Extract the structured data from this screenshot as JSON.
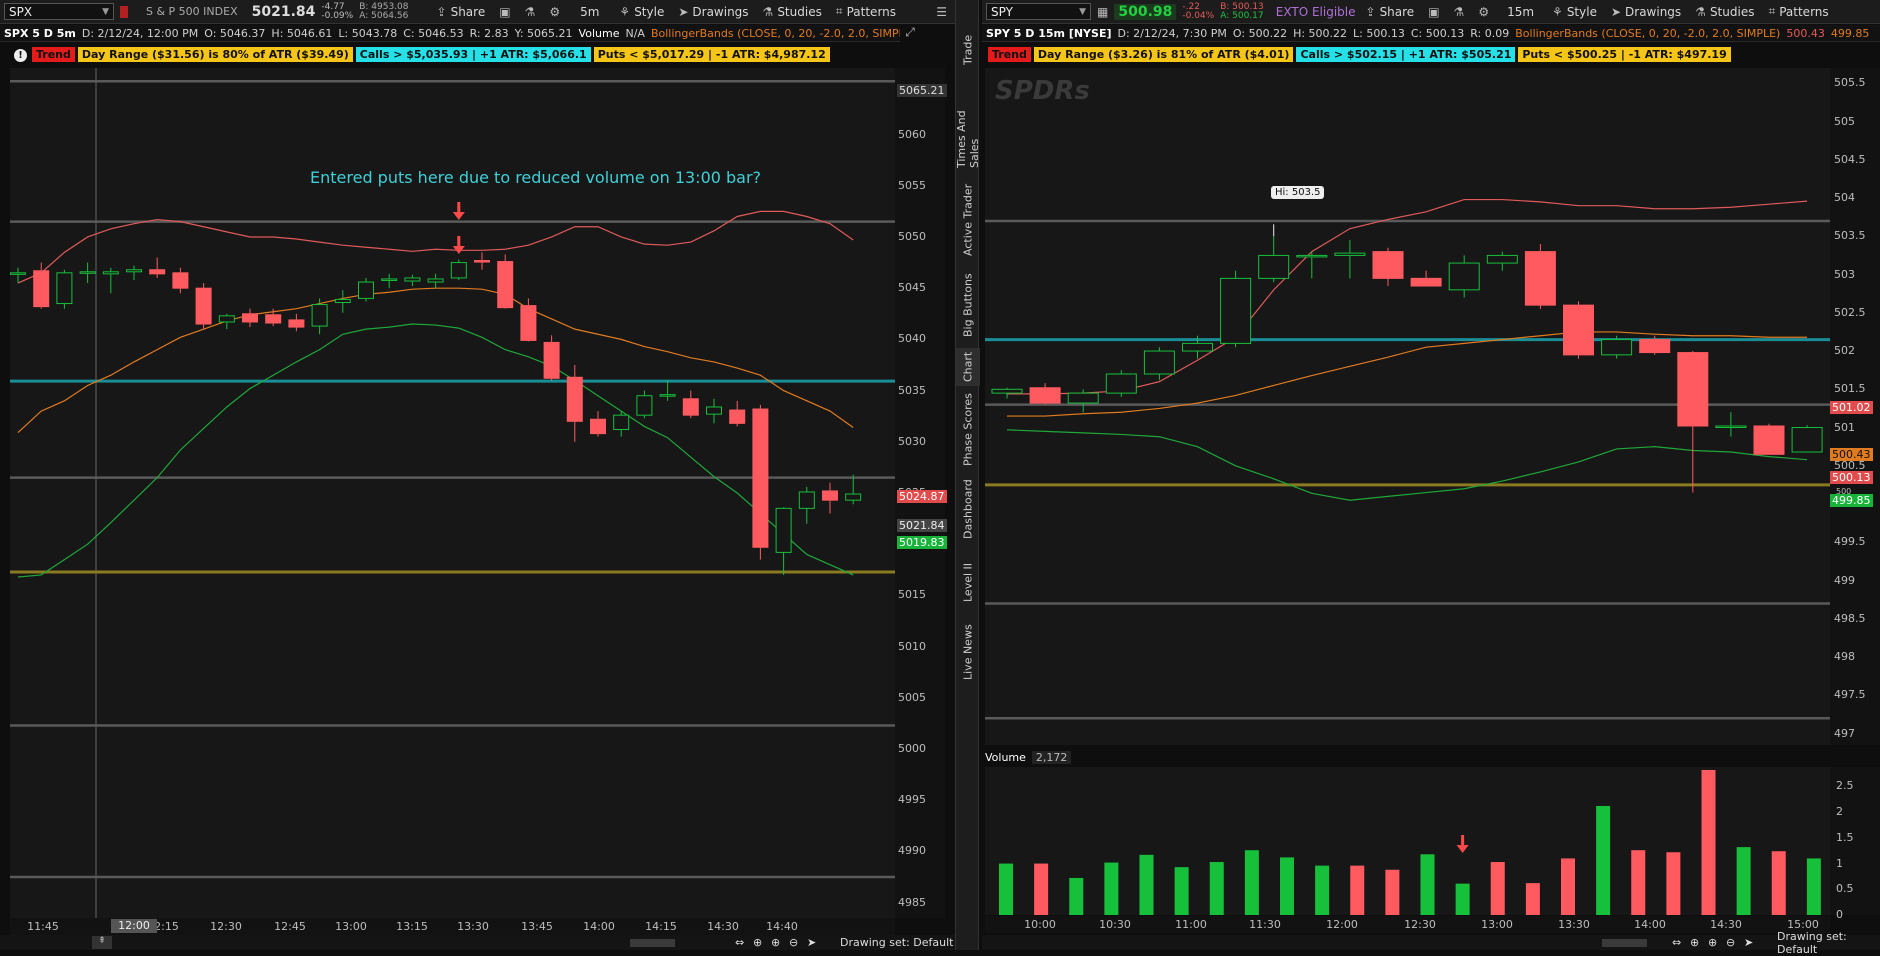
{
  "left": {
    "toolbar": {
      "symbol": "SPX",
      "name": "S & P 500 INDEX",
      "last": "5021.84",
      "change": "-4.77",
      "change_pct": "-0.09%",
      "bid": "B: 4953.08",
      "ask": "A: 5064.56",
      "share": "Share",
      "interval": "5m",
      "style": "Style",
      "drawings": "Drawings",
      "studies": "Studies",
      "patterns": "Patterns"
    },
    "info": {
      "title": "SPX 5 D 5m",
      "date": "D: 2/12/24, 12:00 PM",
      "open": "O: 5046.37",
      "high": "H: 5046.61",
      "low": "L: 5043.78",
      "close": "C: 5046.53",
      "range": "R: 2.83",
      "y": "Y: 5065.21",
      "volume_label": "Volume",
      "volume": "N/A",
      "study": "BollingerBands (CLOSE, 0, 20, -2.0, 2.0, SIMPLE)"
    },
    "tags": [
      "Trend",
      "Day Range ($31.56) is 80% of ATR ($39.49)",
      "Calls > $5,035.93 | +1 ATR: $5,066.1",
      "Puts < $5,017.29 | -1 ATR: $4,987.12"
    ],
    "annotation": "Entered puts here due to reduced volume on 13:00 bar?",
    "price_ticks": [
      "5060",
      "5055",
      "5050",
      "5045",
      "5040",
      "5035",
      "5030",
      "5025",
      "5020",
      "5015",
      "5010",
      "5005",
      "5000",
      "4995",
      "4990",
      "4985"
    ],
    "price_tags": {
      "top": "5065.21",
      "red": "5024.87",
      "gray": "5021.84",
      "green": "5019.83"
    },
    "x_ticks": [
      "11:45",
      "12:00",
      "12:15",
      "12:30",
      "12:45",
      "13:00",
      "13:15",
      "13:30",
      "13:45",
      "14:00",
      "14:15",
      "14:30",
      "14:40"
    ],
    "drawing_set": "Drawing set: Default"
  },
  "right": {
    "toolbar": {
      "symbol": "SPY",
      "last": "500.98",
      "change": "-.22",
      "change_pct": "-0.04%",
      "bid": "B: 500.13",
      "ask": "A: 500.17",
      "exto": "EXTO Eligible",
      "share": "Share",
      "interval": "15m",
      "style": "Style",
      "drawings": "Drawings",
      "studies": "Studies",
      "patterns": "Patterns"
    },
    "info": {
      "title": "SPY 5 D 15m [NYSE]",
      "date": "D: 2/12/24, 7:30 PM",
      "open": "O: 500.22",
      "high": "H: 500.22",
      "low": "L: 500.13",
      "close": "C: 500.13",
      "range": "R: 0.09",
      "study": "BollingerBands (CLOSE, 0, 20, -2.0, 2.0, SIMPLE)",
      "bb1": "500.43",
      "bb2": "499.85"
    },
    "tags": [
      "Trend",
      "Day Range ($3.26) is 81% of ATR ($4.01)",
      "Calls > $502.15 | +1 ATR: $505.21",
      "Puts < $500.25 | -1 ATR: $497.19"
    ],
    "watermark": "SPDRs",
    "hi_label": "Hi: 503.5",
    "price_ticks": [
      "505.5",
      "505",
      "504.5",
      "504",
      "503.5",
      "503",
      "502.5",
      "502",
      "501.5",
      "501",
      "500.5",
      "500",
      "499.5",
      "499",
      "498.5",
      "498",
      "497.5",
      "497"
    ],
    "price_tags": {
      "red1": "501.02",
      "orange": "500.43",
      "red2": "500.13",
      "green": "499.85",
      "tiny": "500"
    },
    "volume_label": "Volume",
    "volume_value": "2,172",
    "vol_ticks": [
      "2.5",
      "2",
      "1.5",
      "1",
      "0.5",
      "0"
    ],
    "x_ticks": [
      "10:00",
      "10:30",
      "11:00",
      "11:30",
      "12:00",
      "12:30",
      "13:00",
      "13:30",
      "14:00",
      "14:30",
      "15:00"
    ],
    "drawing_set": "Drawing set: Default"
  },
  "sidebar": [
    "Trade",
    "Times And Sales",
    "Active Trader",
    "Big Buttons",
    "Chart",
    "Phase Scores",
    "Dashboard",
    "Level II",
    "Live News"
  ],
  "colors": {
    "up": "#16c03b",
    "down": "#ff5a5f",
    "upper_band": "#e05a5a",
    "mid_band": "#e07b20",
    "lower_band": "#1fa83a",
    "cyan_line": "#1a8e96",
    "olive_line": "#8a7a20",
    "gray_line": "#666666",
    "annotation": "#3fd0d8"
  },
  "chart_data": [
    {
      "type": "candlestick",
      "title": "SPX 5 D 5m",
      "x": [
        "11:40",
        "11:45",
        "11:50",
        "11:55",
        "12:00",
        "12:05",
        "12:10",
        "12:15",
        "12:20",
        "12:25",
        "12:30",
        "12:35",
        "12:40",
        "12:45",
        "12:50",
        "12:55",
        "13:00",
        "13:05",
        "13:10",
        "13:15",
        "13:20",
        "13:25",
        "13:30",
        "13:35",
        "13:40",
        "13:45",
        "13:50",
        "13:55",
        "14:00",
        "14:05",
        "14:10",
        "14:15",
        "14:20",
        "14:25",
        "14:30",
        "14:35",
        "14:40"
      ],
      "ohlc": [
        [
          5046.5,
          5047,
          5045.5,
          5046.5
        ],
        [
          5046.7,
          5047.5,
          5043,
          5043.2
        ],
        [
          5043.5,
          5046.8,
          5043,
          5046.5
        ],
        [
          5046.5,
          5047.5,
          5045.5,
          5046.6
        ],
        [
          5046.4,
          5047,
          5044.5,
          5046.6
        ],
        [
          5046.6,
          5047.2,
          5045.8,
          5046.8
        ],
        [
          5046.8,
          5048,
          5046,
          5046.4
        ],
        [
          5046.5,
          5047,
          5044.5,
          5045
        ],
        [
          5045,
          5045.5,
          5041,
          5041.5
        ],
        [
          5041.7,
          5042.5,
          5041,
          5042.3
        ],
        [
          5042.5,
          5043,
          5041.2,
          5041.7
        ],
        [
          5042.4,
          5043,
          5041.3,
          5041.6
        ],
        [
          5041.9,
          5042.5,
          5040.8,
          5041.2
        ],
        [
          5041.3,
          5044,
          5040.5,
          5043.4
        ],
        [
          5043.6,
          5044.8,
          5042.6,
          5043.9
        ],
        [
          5044,
          5046,
          5043.7,
          5045.6
        ],
        [
          5045.8,
          5046.4,
          5045,
          5045.9
        ],
        [
          5045.7,
          5046.3,
          5045.2,
          5046
        ],
        [
          5045.6,
          5046.4,
          5045,
          5045.9
        ],
        [
          5046,
          5047.8,
          5045.8,
          5047.5
        ],
        [
          5047.7,
          5048.5,
          5046.8,
          5047.6
        ],
        [
          5047.6,
          5048.3,
          5043,
          5043.1
        ],
        [
          5043.3,
          5044,
          5039.8,
          5039.9
        ],
        [
          5039.7,
          5040.4,
          5036,
          5036.2
        ],
        [
          5036.3,
          5037.5,
          5030,
          5032
        ],
        [
          5032.2,
          5033,
          5030.5,
          5030.8
        ],
        [
          5031.2,
          5033,
          5030.5,
          5032.6
        ],
        [
          5032.6,
          5035,
          5032.3,
          5034.5
        ],
        [
          5034.5,
          5036,
          5034,
          5034.6
        ],
        [
          5034.2,
          5035,
          5032.3,
          5032.6
        ],
        [
          5032.7,
          5034.2,
          5031.8,
          5033.4
        ],
        [
          5033.1,
          5034,
          5031.5,
          5031.8
        ],
        [
          5033.2,
          5033.6,
          5018.5,
          5019.7
        ],
        [
          5019.2,
          5023.6,
          5017,
          5023.5
        ],
        [
          5023.5,
          5025.6,
          5022,
          5025.1
        ],
        [
          5025.2,
          5026,
          5023,
          5024.3
        ],
        [
          5024.3,
          5026.8,
          5023.9,
          5024.9
        ]
      ],
      "upper_band": [
        5045.5,
        5046.5,
        5048.5,
        5050,
        5050.8,
        5051.3,
        5051.7,
        5051.5,
        5051,
        5050.5,
        5050,
        5050,
        5049.8,
        5049.5,
        5049.2,
        5049,
        5048.8,
        5048.6,
        5048.8,
        5048.7,
        5048.7,
        5048.8,
        5049.2,
        5050,
        5051,
        5051,
        5050,
        5049.3,
        5049.2,
        5049.5,
        5050.6,
        5052,
        5052.5,
        5052.5,
        5052,
        5051.3,
        5049.7
      ],
      "middle_band": [
        5030.9,
        5033,
        5034,
        5035.5,
        5036.5,
        5037.8,
        5039,
        5040.2,
        5041,
        5041.8,
        5042.4,
        5042.7,
        5043,
        5043.5,
        5044,
        5044.4,
        5044.6,
        5044.9,
        5045,
        5045,
        5044.9,
        5044.4,
        5043,
        5042,
        5041,
        5040.5,
        5040,
        5039.3,
        5038.8,
        5038.2,
        5037.8,
        5037.2,
        5036.5,
        5035,
        5034,
        5033,
        5031.4
      ],
      "lower_band": [
        5016.8,
        5017,
        5018.5,
        5020,
        5022.1,
        5024.3,
        5026.5,
        5029.2,
        5031.3,
        5033.4,
        5035.2,
        5036.5,
        5037.8,
        5039,
        5040.5,
        5041,
        5041.2,
        5041.5,
        5041.4,
        5041.1,
        5040.2,
        5039,
        5038.3,
        5037.4,
        5036,
        5034.5,
        5033,
        5031.5,
        5030.4,
        5028.5,
        5026.6,
        5025,
        5023,
        5021,
        5019,
        5018,
        5017
      ],
      "hlines": {
        "gray": [
          5065.21,
          5051.5,
          5026.5,
          5002.3,
          4987.5
        ],
        "cyan": [
          5035.93
        ],
        "olive": [
          5017.29
        ]
      },
      "ylim": [
        4983.5,
        5066.5
      ],
      "annotations": [
        {
          "text": "Entered puts here due to reduced volume on 13:00 bar?",
          "x": "13:15"
        }
      ]
    },
    {
      "type": "candlestick",
      "title": "SPY 5 D 15m [NYSE]",
      "x": [
        "09:45",
        "10:00",
        "10:15",
        "10:30",
        "10:45",
        "11:00",
        "11:15",
        "11:30",
        "11:45",
        "12:00",
        "12:15",
        "12:30",
        "12:45",
        "13:00",
        "13:15",
        "13:30",
        "13:45",
        "14:00",
        "14:15",
        "14:30",
        "14:45",
        "15:00"
      ],
      "ohlc": [
        [
          501.45,
          501.52,
          501.38,
          501.5
        ],
        [
          501.52,
          501.58,
          501.3,
          501.32
        ],
        [
          501.32,
          501.5,
          501.2,
          501.45
        ],
        [
          501.45,
          501.75,
          501.4,
          501.7
        ],
        [
          501.7,
          502.05,
          501.62,
          502
        ],
        [
          502,
          502.2,
          501.9,
          502.1
        ],
        [
          502.1,
          503.05,
          502.05,
          502.95
        ],
        [
          502.95,
          503.5,
          502.9,
          503.25
        ],
        [
          503.25,
          503.3,
          502.95,
          503.25
        ],
        [
          503.25,
          503.45,
          502.95,
          503.28
        ],
        [
          503.3,
          503.35,
          502.85,
          502.95
        ],
        [
          502.95,
          503.05,
          502.85,
          502.85
        ],
        [
          502.8,
          503.25,
          502.7,
          503.15
        ],
        [
          503.15,
          503.3,
          503.05,
          503.25
        ],
        [
          503.3,
          503.4,
          502.55,
          502.6
        ],
        [
          502.6,
          502.65,
          501.9,
          501.95
        ],
        [
          501.95,
          502.2,
          501.9,
          502.15
        ],
        [
          502.15,
          502.2,
          501.95,
          501.98
        ],
        [
          501.98,
          502,
          500.15,
          501.02
        ],
        [
          501.02,
          501.2,
          500.88,
          501.02
        ],
        [
          501.02,
          501.05,
          500.65,
          500.65
        ],
        [
          500.68,
          501.03,
          500.68,
          501
        ]
      ],
      "upper_band": [
        501.44,
        501.44,
        501.45,
        501.48,
        501.6,
        501.88,
        502.18,
        502.8,
        503.3,
        503.6,
        503.72,
        503.82,
        503.98,
        503.98,
        503.95,
        503.9,
        503.9,
        503.86,
        503.86,
        503.88,
        503.92,
        503.96
      ],
      "middle_band": [
        501.15,
        501.15,
        501.18,
        501.2,
        501.25,
        501.32,
        501.42,
        501.55,
        501.68,
        501.8,
        501.92,
        502.05,
        502.1,
        502.15,
        502.2,
        502.25,
        502.25,
        502.22,
        502.2,
        502.2,
        502.18,
        502.18
      ],
      "lower_band": [
        500.97,
        500.95,
        500.93,
        500.91,
        500.88,
        500.75,
        500.5,
        500.33,
        500.14,
        500.05,
        500.1,
        500.15,
        500.2,
        500.3,
        500.42,
        500.55,
        500.72,
        500.75,
        500.7,
        500.68,
        500.62,
        500.58
      ],
      "hlines": {
        "gray": [
          503.7,
          501.3,
          498.7,
          497.2
        ],
        "cyan": [
          502.15
        ],
        "olive": [
          500.25
        ]
      },
      "ylim": [
        496.85,
        505.7
      ],
      "hi_label": "Hi: 503.5",
      "volume": {
        "ylim": [
          0,
          2.8
        ],
        "values": [
          1.0,
          1.0,
          0.72,
          1.02,
          1.17,
          0.93,
          1.03,
          1.26,
          1.12,
          0.96,
          0.96,
          0.88,
          1.18,
          0.61,
          1.03,
          0.62,
          1.1,
          2.12,
          1.26,
          1.22,
          2.82,
          1.32,
          1.24,
          1.1
        ],
        "colors": [
          "up",
          "down",
          "up",
          "up",
          "up",
          "up",
          "up",
          "up",
          "up",
          "up",
          "down",
          "down",
          "up",
          "up",
          "down",
          "down",
          "down",
          "up",
          "down",
          "down",
          "down",
          "up"
        ]
      }
    }
  ]
}
